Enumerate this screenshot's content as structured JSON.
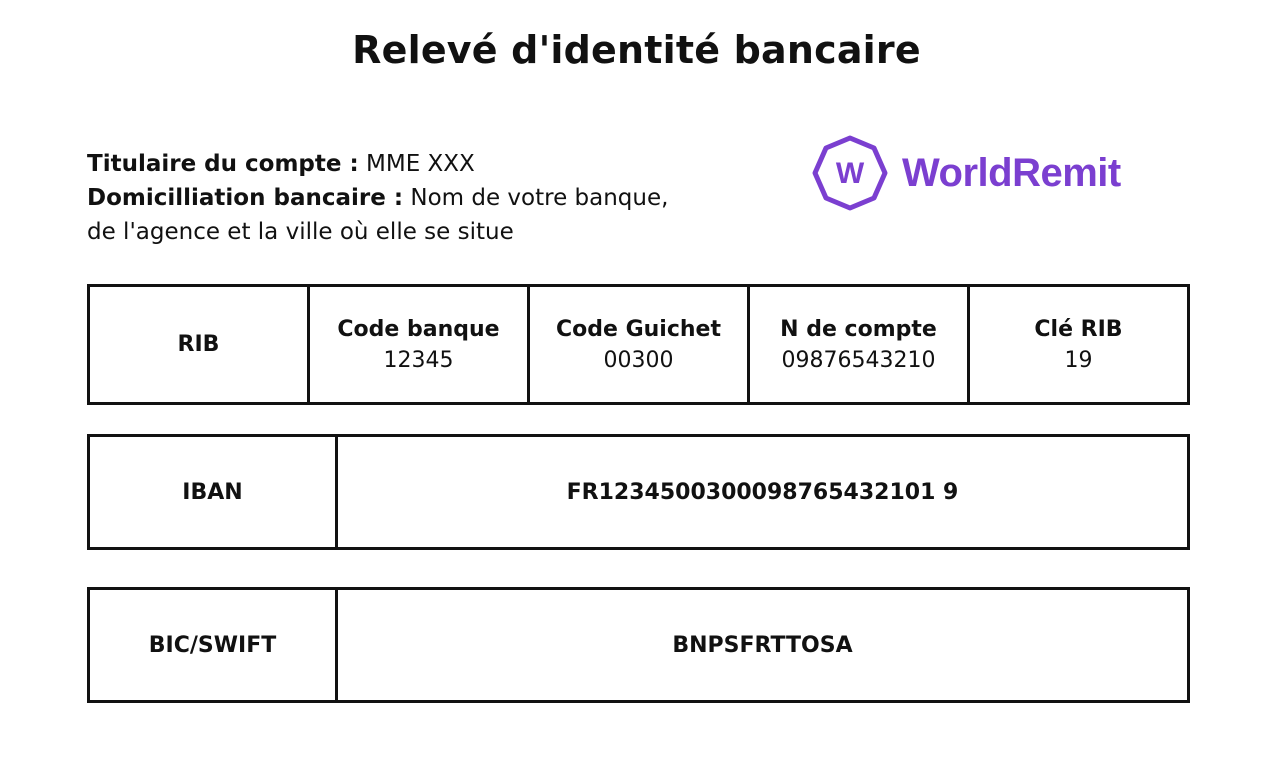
{
  "title": "Relevé d'identité bancaire",
  "holder": {
    "account_holder_label": "Titulaire du compte :",
    "account_holder_value": "MME XXX",
    "bank_domicile_label": "Domicilliation bancaire :",
    "bank_domicile_value_line1": "Nom de votre banque,",
    "bank_domicile_value_line2": "de l'agence et la ville où elle se situe"
  },
  "logo": {
    "mark_letter": "W",
    "text": "WorldRemit",
    "color": "#7B3FD0"
  },
  "rib": {
    "label": "RIB",
    "columns": [
      {
        "header": "Code banque",
        "value": "12345"
      },
      {
        "header": "Code Guichet",
        "value": "00300"
      },
      {
        "header": "N de compte",
        "value": "09876543210"
      },
      {
        "header": "Clé RIB",
        "value": "19"
      }
    ]
  },
  "iban": {
    "label": "IBAN",
    "value": "FR1234500300098765432101 9"
  },
  "bic": {
    "label": "BIC/SWIFT",
    "value": "BNPSFRTTOSA"
  }
}
